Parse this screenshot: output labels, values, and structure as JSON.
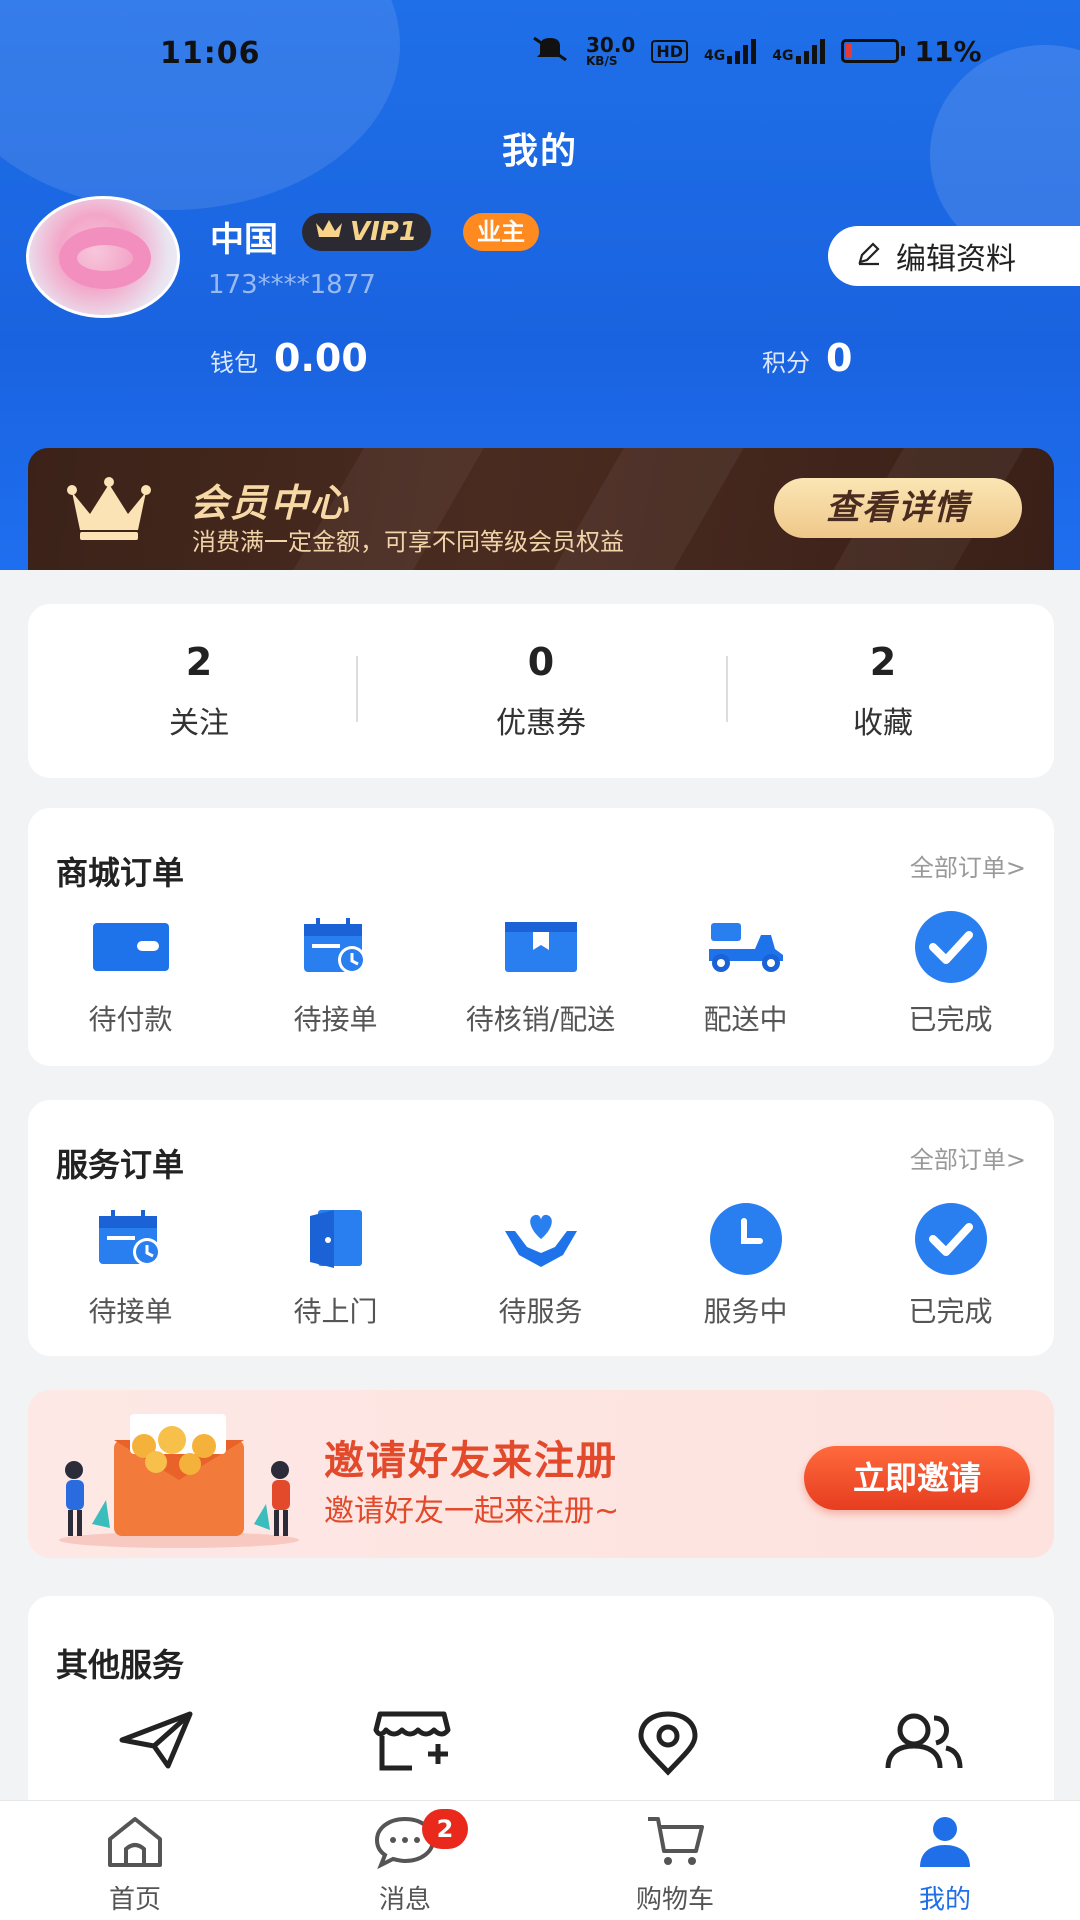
{
  "status_bar": {
    "time": "11:06",
    "net_speed": "30.0",
    "net_unit": "KB/S",
    "hd": "HD",
    "sim1": "4G",
    "sim2": "4G",
    "battery": "11%"
  },
  "header": {
    "title": "我的"
  },
  "profile": {
    "name": "中国",
    "vip": "VIP1",
    "role": "业主",
    "phone": "173****1877",
    "edit_label": "编辑资料",
    "wallet_label": "钱包",
    "wallet_value": "0.00",
    "points_label": "积分",
    "points_value": "0"
  },
  "member_card": {
    "title": "会员中心",
    "subtitle": "消费满一定金额，可享不同等级会员权益",
    "button": "查看详情"
  },
  "stats": [
    {
      "value": "2",
      "label": "关注"
    },
    {
      "value": "0",
      "label": "优惠券"
    },
    {
      "value": "2",
      "label": "收藏"
    }
  ],
  "mall_orders": {
    "title": "商城订单",
    "link": "全部订单>",
    "items": [
      {
        "label": "待付款",
        "icon": "wallet-icon"
      },
      {
        "label": "待接单",
        "icon": "calendar-clock-icon"
      },
      {
        "label": "待核销/配送",
        "icon": "box-icon"
      },
      {
        "label": "配送中",
        "icon": "scooter-icon"
      },
      {
        "label": "已完成",
        "icon": "check-circle-icon"
      }
    ]
  },
  "service_orders": {
    "title": "服务订单",
    "link": "全部订单>",
    "items": [
      {
        "label": "待接单",
        "icon": "calendar-clock-icon"
      },
      {
        "label": "待上门",
        "icon": "door-icon"
      },
      {
        "label": "待服务",
        "icon": "heart-hands-icon"
      },
      {
        "label": "服务中",
        "icon": "clock-icon"
      },
      {
        "label": "已完成",
        "icon": "check-circle-icon"
      }
    ]
  },
  "invite": {
    "title": "邀请好友来注册",
    "subtitle": "邀请好友一起来注册~",
    "button": "立即邀请"
  },
  "other_services": {
    "title": "其他服务",
    "icons": [
      "send-icon",
      "store-add-icon",
      "location-icon",
      "users-icon"
    ]
  },
  "tabbar": {
    "items": [
      {
        "label": "首页",
        "icon": "home-icon"
      },
      {
        "label": "消息",
        "icon": "chat-icon",
        "badge": "2"
      },
      {
        "label": "购物车",
        "icon": "cart-icon"
      },
      {
        "label": "我的",
        "icon": "user-icon"
      }
    ],
    "active_index": 3
  },
  "colors": {
    "primary": "#1f6fe8",
    "accent_orange": "#ff8a1f",
    "invite_red": "#e24a2b",
    "badge_red": "#e8291c"
  }
}
